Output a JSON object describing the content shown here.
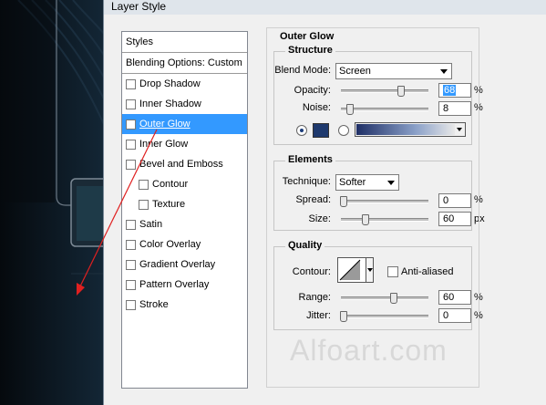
{
  "dialog": {
    "title": "Layer Style"
  },
  "styles_list": {
    "header": "Styles",
    "blending": "Blending Options: Custom",
    "items": [
      {
        "label": "Drop Shadow",
        "checked": false,
        "indent": 0
      },
      {
        "label": "Inner Shadow",
        "checked": false,
        "indent": 0
      },
      {
        "label": "Outer Glow",
        "checked": true,
        "selected": true,
        "indent": 0
      },
      {
        "label": "Inner Glow",
        "checked": false,
        "indent": 0
      },
      {
        "label": "Bevel and Emboss",
        "checked": false,
        "indent": 0
      },
      {
        "label": "Contour",
        "checked": false,
        "indent": 1
      },
      {
        "label": "Texture",
        "checked": false,
        "indent": 1
      },
      {
        "label": "Satin",
        "checked": false,
        "indent": 0
      },
      {
        "label": "Color Overlay",
        "checked": false,
        "indent": 0
      },
      {
        "label": "Gradient Overlay",
        "checked": false,
        "indent": 0
      },
      {
        "label": "Pattern Overlay",
        "checked": false,
        "indent": 0
      },
      {
        "label": "Stroke",
        "checked": false,
        "indent": 0
      }
    ]
  },
  "panel": {
    "title": "Outer Glow",
    "structure": {
      "title": "Structure",
      "blend_mode_label": "Blend Mode:",
      "blend_mode": "Screen",
      "opacity_label": "Opacity:",
      "opacity": "68",
      "opacity_unit": "%",
      "noise_label": "Noise:",
      "noise": "8",
      "noise_unit": "%"
    },
    "elements": {
      "title": "Elements",
      "technique_label": "Technique:",
      "technique": "Softer",
      "spread_label": "Spread:",
      "spread": "0",
      "spread_unit": "%",
      "size_label": "Size:",
      "size": "60",
      "size_unit": "px"
    },
    "quality": {
      "title": "Quality",
      "contour_label": "Contour:",
      "anti_aliased_label": "Anti-aliased",
      "range_label": "Range:",
      "range": "60",
      "range_unit": "%",
      "jitter_label": "Jitter:",
      "jitter": "0",
      "jitter_unit": "%"
    },
    "glow_color": "#1f3a6e"
  },
  "watermark": "Alfoart.com",
  "icons": [
    "check-icon",
    "chevron-down-icon",
    "radio-icon",
    "arrow-annotation-icon"
  ]
}
